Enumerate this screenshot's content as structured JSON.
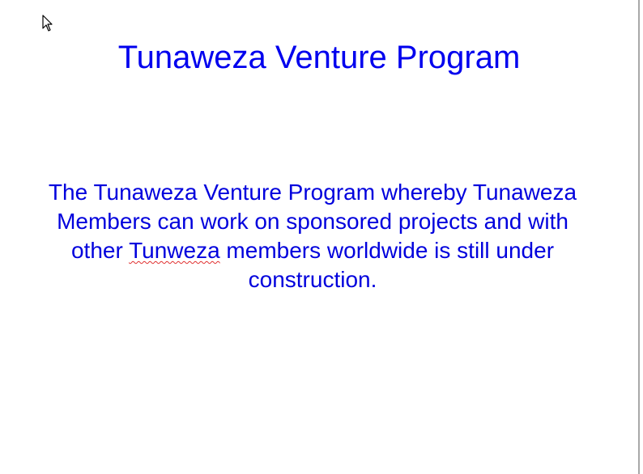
{
  "slide": {
    "title": "Tunaweza Venture Program",
    "body_before": "The Tunaweza Venture Program whereby Tunaweza Members can work on sponsored projects and with other ",
    "body_misspelled": "Tunweza",
    "body_after": " members worldwide is still under construction."
  },
  "colors": {
    "title": "#0000ee",
    "body": "#0000dd",
    "spellcheck_underline": "#e03030",
    "background": "#ffffff"
  },
  "icons": {
    "cursor": "mouse-pointer-arrow-icon"
  }
}
